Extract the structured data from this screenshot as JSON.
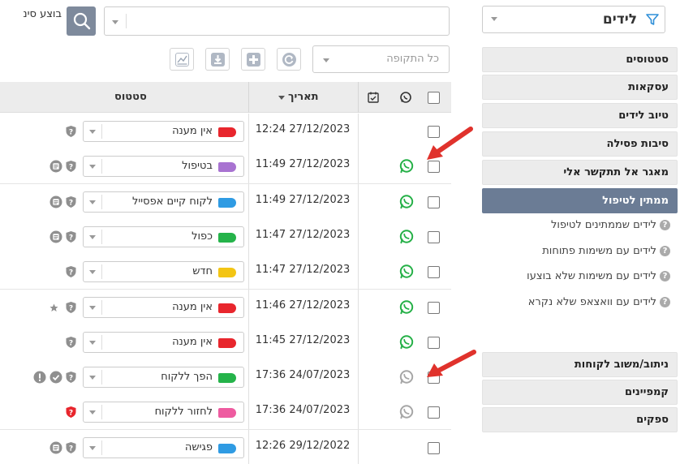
{
  "colors": {
    "accent": "#6b7c95",
    "whatsapp_active": "#25b047",
    "whatsapp_inactive": "#a6a6a6",
    "arrow": "#e0322c",
    "tag_red": "#e8262d",
    "tag_purple": "#a873d1",
    "tag_blue": "#2f9be3",
    "tag_green": "#25b34a",
    "tag_yellow": "#f3c514",
    "tag_pink": "#ee5ba0"
  },
  "leads_selector": {
    "title": "לידים",
    "icon": "funnel-icon"
  },
  "sidebar": {
    "menu": [
      "סטטוסים",
      "עסקאות",
      "טיוב לידים",
      "סיבות פסילה",
      "מאגר אל תתקשר אלי",
      "ממתין לטיפול"
    ],
    "active_index": 5,
    "sub_items": [
      "לידים שממתינים לטיפול",
      "לידים עם משימות פתוחות",
      "לידים עם משימות שלא בוצעו",
      "לידים עם וואצאפ שלא נקרא"
    ],
    "menu2": [
      "ניתוב/משוב לקוחות",
      "קמפיינים",
      "ספקים"
    ]
  },
  "search": {
    "performed_label": "בוצע סינ",
    "value": ""
  },
  "toolbar": {
    "period_label": "כל התקופה",
    "icons": [
      "refresh-icon",
      "add-icon",
      "download-icon",
      "chart-icon"
    ]
  },
  "table": {
    "headers": {
      "status": "סטטוס",
      "date": "תאריך"
    },
    "rows": [
      {
        "date": "12:24 27/12/2023",
        "status": "אין מענה",
        "tag": "red",
        "wa": "none",
        "icons": [
          "shield"
        ]
      },
      {
        "date": "11:49 27/12/2023",
        "status": "בטיפול",
        "tag": "purple",
        "wa": "active",
        "icons": [
          "note",
          "shield"
        ]
      },
      {
        "date": "11:49 27/12/2023",
        "status": "לקוח קיים אפסייל",
        "tag": "blue",
        "wa": "active",
        "icons": [
          "note",
          "shield"
        ]
      },
      {
        "date": "11:47 27/12/2023",
        "status": "כפול",
        "tag": "green",
        "wa": "active",
        "icons": [
          "note",
          "shield"
        ]
      },
      {
        "date": "11:47 27/12/2023",
        "status": "חדש",
        "tag": "yellow",
        "wa": "active",
        "icons": [
          "shield"
        ]
      },
      {
        "date": "11:46 27/12/2023",
        "status": "אין מענה",
        "tag": "red",
        "wa": "active",
        "icons": [
          "star",
          "shield"
        ]
      },
      {
        "date": "11:45 27/12/2023",
        "status": "אין מענה",
        "tag": "red",
        "wa": "active",
        "icons": [
          "shield"
        ]
      },
      {
        "date": "17:36 24/07/2023",
        "status": "הפך ללקוח",
        "tag": "green",
        "wa": "inactive",
        "icons": [
          "alert",
          "check",
          "shield"
        ]
      },
      {
        "date": "17:36 24/07/2023",
        "status": "לחזור ללקוח",
        "tag": "pink",
        "wa": "inactive",
        "icons": [
          "shield-red"
        ]
      },
      {
        "date": "12:26 29/12/2022",
        "status": "פגישה",
        "tag": "blue",
        "wa": "none",
        "icons": [
          "note",
          "shield"
        ]
      }
    ]
  }
}
